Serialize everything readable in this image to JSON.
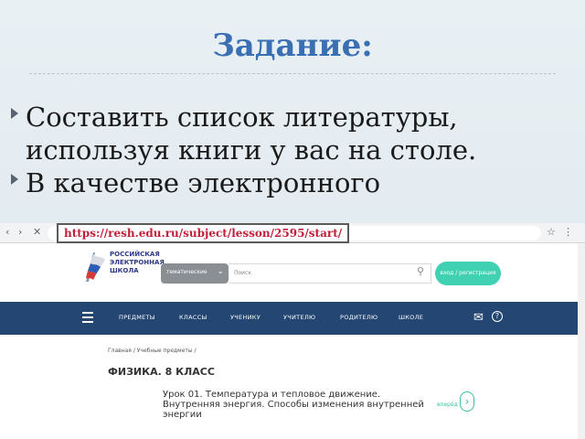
{
  "slide": {
    "title": "Задание:",
    "bullets": [
      "Составить список литературы, используя книги у вас на столе.",
      "В качестве электронного"
    ]
  },
  "browser": {
    "back": "‹",
    "forward": "›",
    "close": "✕",
    "url_label": "https://resh.edu.ru/subject/lesson/2595/start/"
  },
  "site": {
    "logo_lines": [
      "РОССИЙСКАЯ",
      "ЭЛЕКТРОННАЯ",
      "ШКОЛА"
    ],
    "search_select": "тематические",
    "search_placeholder": "Поиск",
    "login_label": "вход / регистрация",
    "nav": [
      "ПРЕДМЕТЫ",
      "КЛАССЫ",
      "УЧЕНИКУ",
      "УЧИТЕЛЮ",
      "РОДИТЕЛЮ",
      "ШКОЛЕ"
    ],
    "breadcrumb": "Главная / Учебные предметы /",
    "course_title": "ФИЗИКА. 8 КЛАСС",
    "lesson_title": "Урок 01. Температура и тепловое движение. Внутренняя энергия. Способы изменения внутренней энергии",
    "next_label": "вперёд"
  },
  "colors": {
    "title": "#3b6fb3",
    "navbar": "#244673",
    "accent": "#3fd1b1",
    "url_text": "#c0203a"
  }
}
